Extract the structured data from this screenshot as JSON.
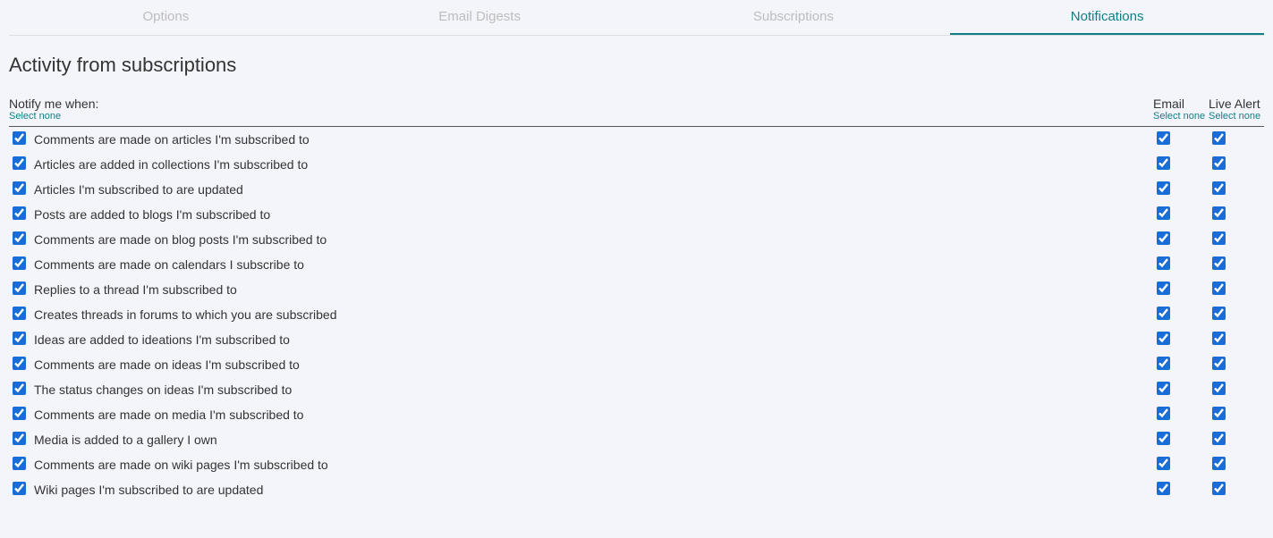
{
  "tabs": {
    "options": {
      "label": "Options",
      "active": false
    },
    "email_digests": {
      "label": "Email Digests",
      "active": false
    },
    "subscriptions": {
      "label": "Subscriptions",
      "active": false
    },
    "notifications": {
      "label": "Notifications",
      "active": true
    }
  },
  "section": {
    "title": "Activity from subscriptions"
  },
  "headers": {
    "notify_label": "Notify me when:",
    "notify_select_none": "Select none",
    "email_label": "Email",
    "email_select_none": "Select none",
    "live_alert_label": "Live Alert",
    "live_alert_select_none": "Select none"
  },
  "rows": [
    {
      "label": "Comments are made on articles I'm subscribed to",
      "enabled": true,
      "email": true,
      "live": true
    },
    {
      "label": "Articles are added in collections I'm subscribed to",
      "enabled": true,
      "email": true,
      "live": true
    },
    {
      "label": "Articles I'm subscribed to are updated",
      "enabled": true,
      "email": true,
      "live": true
    },
    {
      "label": "Posts are added to blogs I'm subscribed to",
      "enabled": true,
      "email": true,
      "live": true
    },
    {
      "label": "Comments are made on blog posts I'm subscribed to",
      "enabled": true,
      "email": true,
      "live": true
    },
    {
      "label": "Comments are made on calendars I subscribe to",
      "enabled": true,
      "email": true,
      "live": true
    },
    {
      "label": "Replies to a thread I'm subscribed to",
      "enabled": true,
      "email": true,
      "live": true
    },
    {
      "label": "Creates threads in forums to which you are subscribed",
      "enabled": true,
      "email": true,
      "live": true
    },
    {
      "label": "Ideas are added to ideations I'm subscribed to",
      "enabled": true,
      "email": true,
      "live": true
    },
    {
      "label": "Comments are made on ideas I'm subscribed to",
      "enabled": true,
      "email": true,
      "live": true
    },
    {
      "label": "The status changes on ideas I'm subscribed to",
      "enabled": true,
      "email": true,
      "live": true
    },
    {
      "label": "Comments are made on media I'm subscribed to",
      "enabled": true,
      "email": true,
      "live": true
    },
    {
      "label": "Media is added to a gallery I own",
      "enabled": true,
      "email": true,
      "live": true
    },
    {
      "label": "Comments are made on wiki pages I'm subscribed to",
      "enabled": true,
      "email": true,
      "live": true
    },
    {
      "label": "Wiki pages I'm subscribed to are updated",
      "enabled": true,
      "email": true,
      "live": true
    }
  ]
}
